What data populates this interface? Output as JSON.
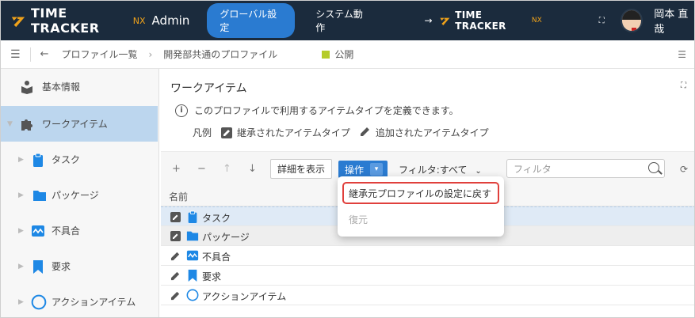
{
  "header": {
    "brand": "TIME TRACKER",
    "brand_suffix": "NX",
    "admin": "Admin",
    "nav_global": "グローバル設定",
    "nav_system": "システム動作",
    "link_arrow": "→",
    "link_brand": "TIME TRACKER",
    "link_brand_suffix": "NX",
    "user_name": "岡本 直哉"
  },
  "breadcrumb": {
    "profile_list": "プロファイル一覧",
    "current": "開発部共通のプロファイル",
    "status": "公開",
    "status_color": "#b5cc2a"
  },
  "sidebar": {
    "items": [
      {
        "label": "基本情報",
        "icon": "book-reader-icon"
      },
      {
        "label": "ワークアイテム",
        "icon": "puzzle-icon"
      },
      {
        "label": "タスク",
        "icon": "clipboard-icon"
      },
      {
        "label": "パッケージ",
        "icon": "folder-icon"
      },
      {
        "label": "不具合",
        "icon": "wave-chart-icon"
      },
      {
        "label": "要求",
        "icon": "bookmark-icon"
      },
      {
        "label": "アクションアイテム",
        "icon": "circle-icon"
      }
    ]
  },
  "main": {
    "title": "ワークアイテム",
    "info": "このプロファイルで利用するアイテムタイプを定義できます。",
    "legend_label": "凡例",
    "legend_inherited": "継承されたアイテムタイプ",
    "legend_added": "追加されたアイテムタイプ"
  },
  "toolbar": {
    "add": "+",
    "remove": "−",
    "up": "↑",
    "down": "↓",
    "detail": "詳細を表示",
    "operation": "操作",
    "filter_select": "フィルタ:すべて",
    "filter_placeholder": "フィルタ"
  },
  "table": {
    "column_name": "名前",
    "rows": [
      {
        "label": "タスク",
        "type": "inherited",
        "icon": "clipboard-icon"
      },
      {
        "label": "パッケージ",
        "type": "inherited",
        "icon": "folder-icon"
      },
      {
        "label": "不具合",
        "type": "added",
        "icon": "wave-chart-icon"
      },
      {
        "label": "要求",
        "type": "added",
        "icon": "bookmark-icon"
      },
      {
        "label": "アクションアイテム",
        "type": "added",
        "icon": "circle-icon"
      }
    ]
  },
  "dropdown": {
    "item1": "継承元プロファイルの設定に戻す",
    "item2": "復元"
  },
  "colors": {
    "topbar": "#1b2b3d",
    "accent": "#2a7bd1",
    "icon_blue": "#1e88e5",
    "highlight_red": "#e0403c"
  }
}
